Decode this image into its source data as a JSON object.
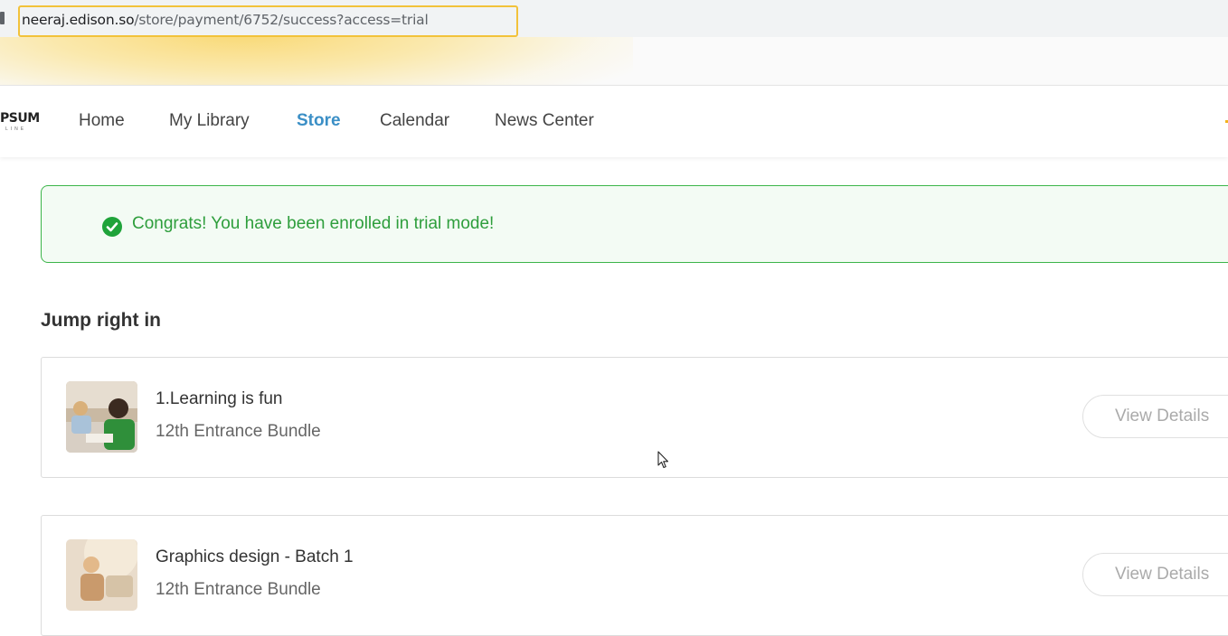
{
  "browser": {
    "url_host": "neeraj.edison.so",
    "url_path": "/store/payment/6752/success?access=trial"
  },
  "site": {
    "logo_text": "PSUM",
    "logo_subtext": "LINE",
    "nav": [
      {
        "label": "Home",
        "active": false
      },
      {
        "label": "My Library",
        "active": false
      },
      {
        "label": "Store",
        "active": true
      },
      {
        "label": "Calendar",
        "active": false
      },
      {
        "label": "News Center",
        "active": false
      }
    ]
  },
  "alert": {
    "message": "Congrats! You have been enrolled in trial mode!",
    "icon": "check-circle-icon",
    "color": "#2e9e3c"
  },
  "section": {
    "title": "Jump right in"
  },
  "courses": [
    {
      "title": "1.Learning is fun",
      "subtitle": "12th Entrance Bundle",
      "button_label": "View Details"
    },
    {
      "title": "Graphics design - Batch 1",
      "subtitle": "12th Entrance Bundle",
      "button_label": "View Details"
    }
  ],
  "colors": {
    "accent": "#3b8fc6",
    "success": "#3cb54a",
    "url_highlight": "#f2c23a"
  }
}
